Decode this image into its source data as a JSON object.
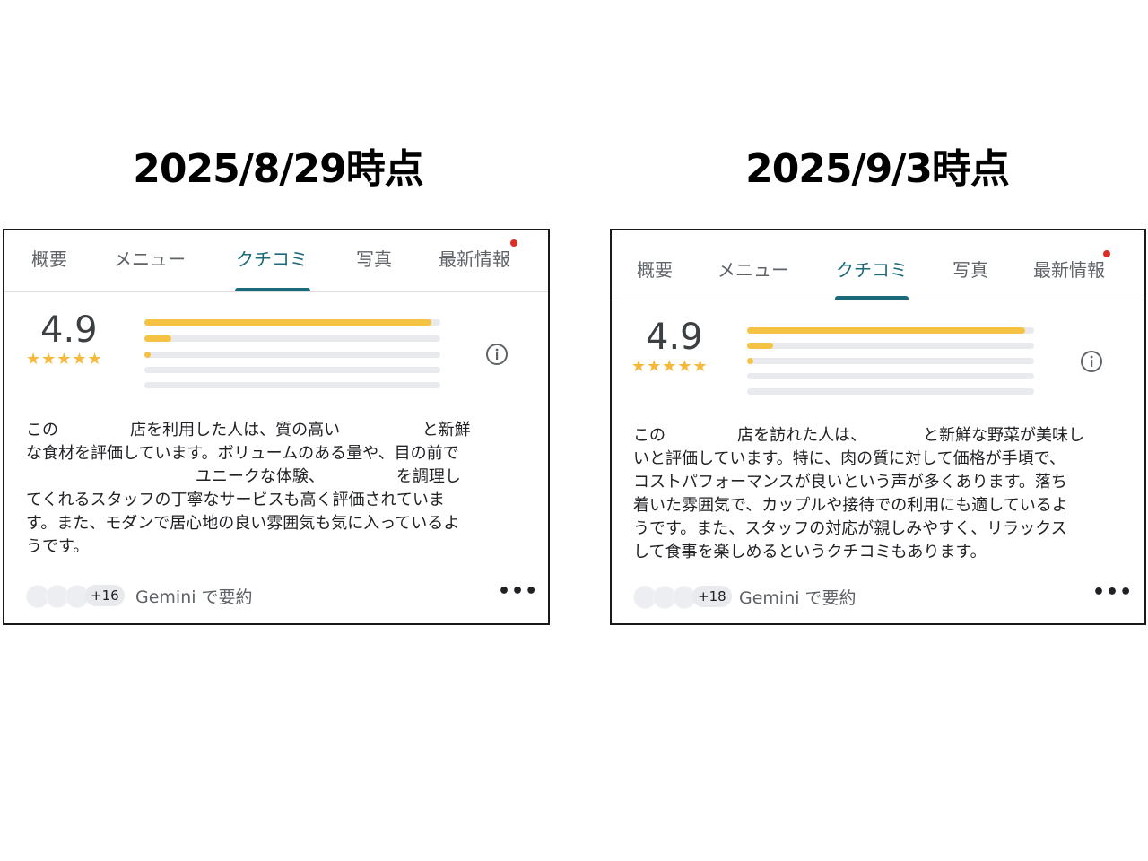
{
  "left": {
    "heading": "2025/8/29時点",
    "tabs": [
      "概要",
      "メニュー",
      "クチコミ",
      "写真",
      "最新情報"
    ],
    "rating": "4.9",
    "stars": "★★★★★",
    "rating_distribution": [
      0.97,
      0.09,
      0.02,
      0,
      0
    ],
    "summary": "この              店を利用した人は、質の高い                と新鮮\nな食材を評価しています。ボリュームのある量や、目の前で\n                                 ユニークな体験、              を調理し\nてくれるスタッフの丁寧なサービスも高く評価されていま\nす。また、モダンで居心地の良い雰囲気も気に入っているよ\nうです。",
    "reviewer_count": "+16",
    "summary_source": "Gemini で要約",
    "more_icon": "more-horiz-icon"
  },
  "right": {
    "heading": "2025/9/3時点",
    "tabs": [
      "概要",
      "メニュー",
      "クチコミ",
      "写真",
      "最新情報"
    ],
    "rating": "4.9",
    "stars": "★★★★★",
    "rating_distribution": [
      0.97,
      0.09,
      0.02,
      0,
      0
    ],
    "summary": "この              店を訪れた人は、           と新鮮な野菜が美味し\nいと評価しています。特に、肉の質に対して価格が手頃で、\nコストパフォーマンスが良いという声が多くあります。落ち\n着いた雰囲気で、カップルや接待での利用にも適しているよ\nうです。また、スタッフの対応が親しみやすく、リラックス\nして食事を楽しめるというクチコミもあります。",
    "reviewer_count": "+18",
    "summary_source": "Gemini で要約",
    "more_icon": "more-horiz-icon"
  },
  "colors": {
    "accent_tab": "#1a6a7a",
    "star": "#f6b93b",
    "bar_fill": "#f6c244",
    "notification_dot": "#d93025"
  }
}
